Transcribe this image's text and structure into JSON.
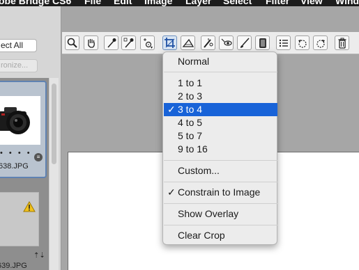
{
  "menubar": {
    "items": [
      "obe Bridge CS6",
      "File",
      "Edit",
      "Image",
      "Layer",
      "Select",
      "Filter",
      "View",
      "Windo"
    ]
  },
  "left_panel": {
    "select_all_label": "ect All",
    "synchronize_label": "ronize...",
    "thumbnails": [
      {
        "caption": "638.JPG",
        "dots": "• • • •"
      },
      {
        "caption": "639.JPG"
      }
    ]
  },
  "toolbar": {
    "tools": [
      "zoom",
      "hand",
      "eyedropper",
      "color-sampler",
      "target-adjustment",
      "crop",
      "straighten",
      "spot-removal",
      "red-eye",
      "adjustment-brush",
      "graduated-filter",
      "preferences",
      "rotate-left",
      "rotate-right",
      "trash"
    ],
    "active_tool": "crop"
  },
  "crop_menu": {
    "items": [
      {
        "label": "Normal",
        "checked": false,
        "selected": false
      },
      {
        "label": "1 to 1",
        "checked": false,
        "selected": false
      },
      {
        "label": "2 to 3",
        "checked": false,
        "selected": false
      },
      {
        "label": "3 to 4",
        "checked": true,
        "selected": true
      },
      {
        "label": "4 to 5",
        "checked": false,
        "selected": false
      },
      {
        "label": "5 to 7",
        "checked": false,
        "selected": false
      },
      {
        "label": "9 to 16",
        "checked": false,
        "selected": false
      },
      {
        "label": "Custom...",
        "checked": false,
        "selected": false
      },
      {
        "label": "Constrain to Image",
        "checked": true,
        "selected": false
      },
      {
        "label": "Show Overlay",
        "checked": false,
        "selected": false
      },
      {
        "label": "Clear Crop",
        "checked": false,
        "selected": false
      }
    ],
    "check_glyph": "✓"
  },
  "colors": {
    "selection": "#1863d8",
    "menubar": "#1c1c1c",
    "thumb_selected_border": "#5f82b2"
  }
}
